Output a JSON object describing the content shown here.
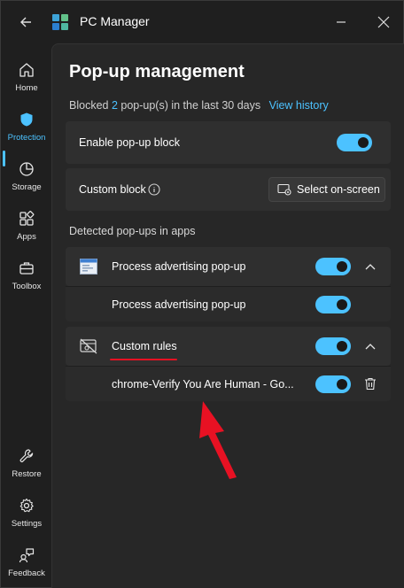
{
  "window": {
    "title": "PC Manager",
    "accent": "#4cc2ff",
    "icons": [
      "back-arrow-icon",
      "app-logo-icon",
      "minimize-icon",
      "maximize-icon",
      "close-icon"
    ]
  },
  "sidebar": {
    "items": [
      {
        "label": "Home",
        "icon": "home-icon",
        "active": false
      },
      {
        "label": "Protection",
        "icon": "shield-icon",
        "active": true
      },
      {
        "label": "Storage",
        "icon": "pie-chart-icon",
        "active": false
      },
      {
        "label": "Apps",
        "icon": "apps-grid-icon",
        "active": false
      },
      {
        "label": "Toolbox",
        "icon": "toolbox-icon",
        "active": false
      },
      {
        "label": "Restore",
        "icon": "wrench-icon",
        "active": false
      },
      {
        "label": "Settings",
        "icon": "gear-icon",
        "active": false
      },
      {
        "label": "Feedback",
        "icon": "feedback-icon",
        "active": false
      }
    ]
  },
  "main": {
    "page_title": "Pop-up management",
    "blocked_prefix": "Blocked ",
    "blocked_count": "2",
    "blocked_suffix": " pop-up(s) in the last 30 days",
    "view_history": "View history",
    "enable_popup_label": "Enable pop-up block",
    "enable_popup_on": true,
    "custom_block_label": "Custom block",
    "select_onscreen_label": "Select on-screen",
    "detected_label": "Detected pop-ups in apps",
    "groups": [
      {
        "title": "Process advertising pop-up",
        "icon": "app-window-icon",
        "enabled": true,
        "expanded": true,
        "items": [
          {
            "label": "Process advertising pop-up",
            "enabled": true
          }
        ]
      },
      {
        "title": "Custom rules",
        "icon": "blocked-window-icon",
        "enabled": true,
        "expanded": true,
        "items": [
          {
            "label": "chrome-Verify You Are Human - Go...",
            "enabled": true,
            "icon": "trash-icon"
          }
        ]
      }
    ]
  },
  "annotation": {
    "color": "#e81123"
  }
}
